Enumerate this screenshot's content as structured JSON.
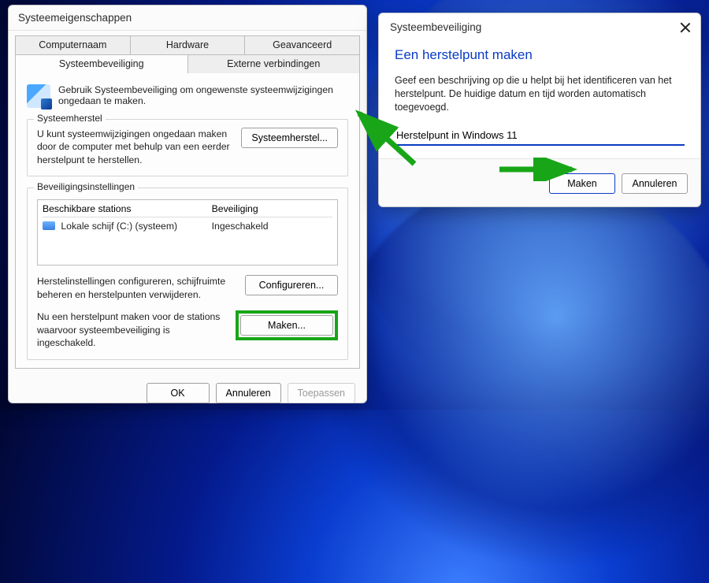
{
  "left": {
    "title": "Systeemeigenschappen",
    "tabs_row1": [
      "Computernaam",
      "Hardware",
      "Geavanceerd"
    ],
    "tabs_row2": [
      "Systeembeveiliging",
      "Externe verbindingen"
    ],
    "active_tab": "Systeembeveiliging",
    "intro": "Gebruik Systeembeveiliging om ongewenste systeemwijzigingen ongedaan te maken.",
    "group_restore": {
      "title": "Systeemherstel",
      "text": "U kunt systeemwijzigingen ongedaan maken door de computer met behulp van een eerder herstelpunt te herstellen.",
      "button": "Systeemherstel..."
    },
    "group_settings": {
      "title": "Beveiligingsinstellingen",
      "col_drive": "Beschikbare stations",
      "col_status": "Beveiliging",
      "row_drive": "Lokale schijf (C:) (systeem)",
      "row_status": "Ingeschakeld",
      "configure_text": "Herstelinstellingen configureren, schijfruimte beheren en herstelpunten verwijderen.",
      "configure_button": "Configureren...",
      "create_text": "Nu een herstelpunt maken voor de stations waarvoor systeembeveiliging is ingeschakeld.",
      "create_button": "Maken..."
    },
    "ok": "OK",
    "cancel": "Annuleren",
    "apply": "Toepassen"
  },
  "right": {
    "title": "Systeembeveiliging",
    "heading": "Een herstelpunt maken",
    "text": "Geef een beschrijving op die u helpt bij het identificeren van het herstelpunt. De huidige datum en tijd worden automatisch toegevoegd.",
    "input_value": "Herstelpunt in Windows 11",
    "make": "Maken",
    "cancel": "Annuleren"
  }
}
